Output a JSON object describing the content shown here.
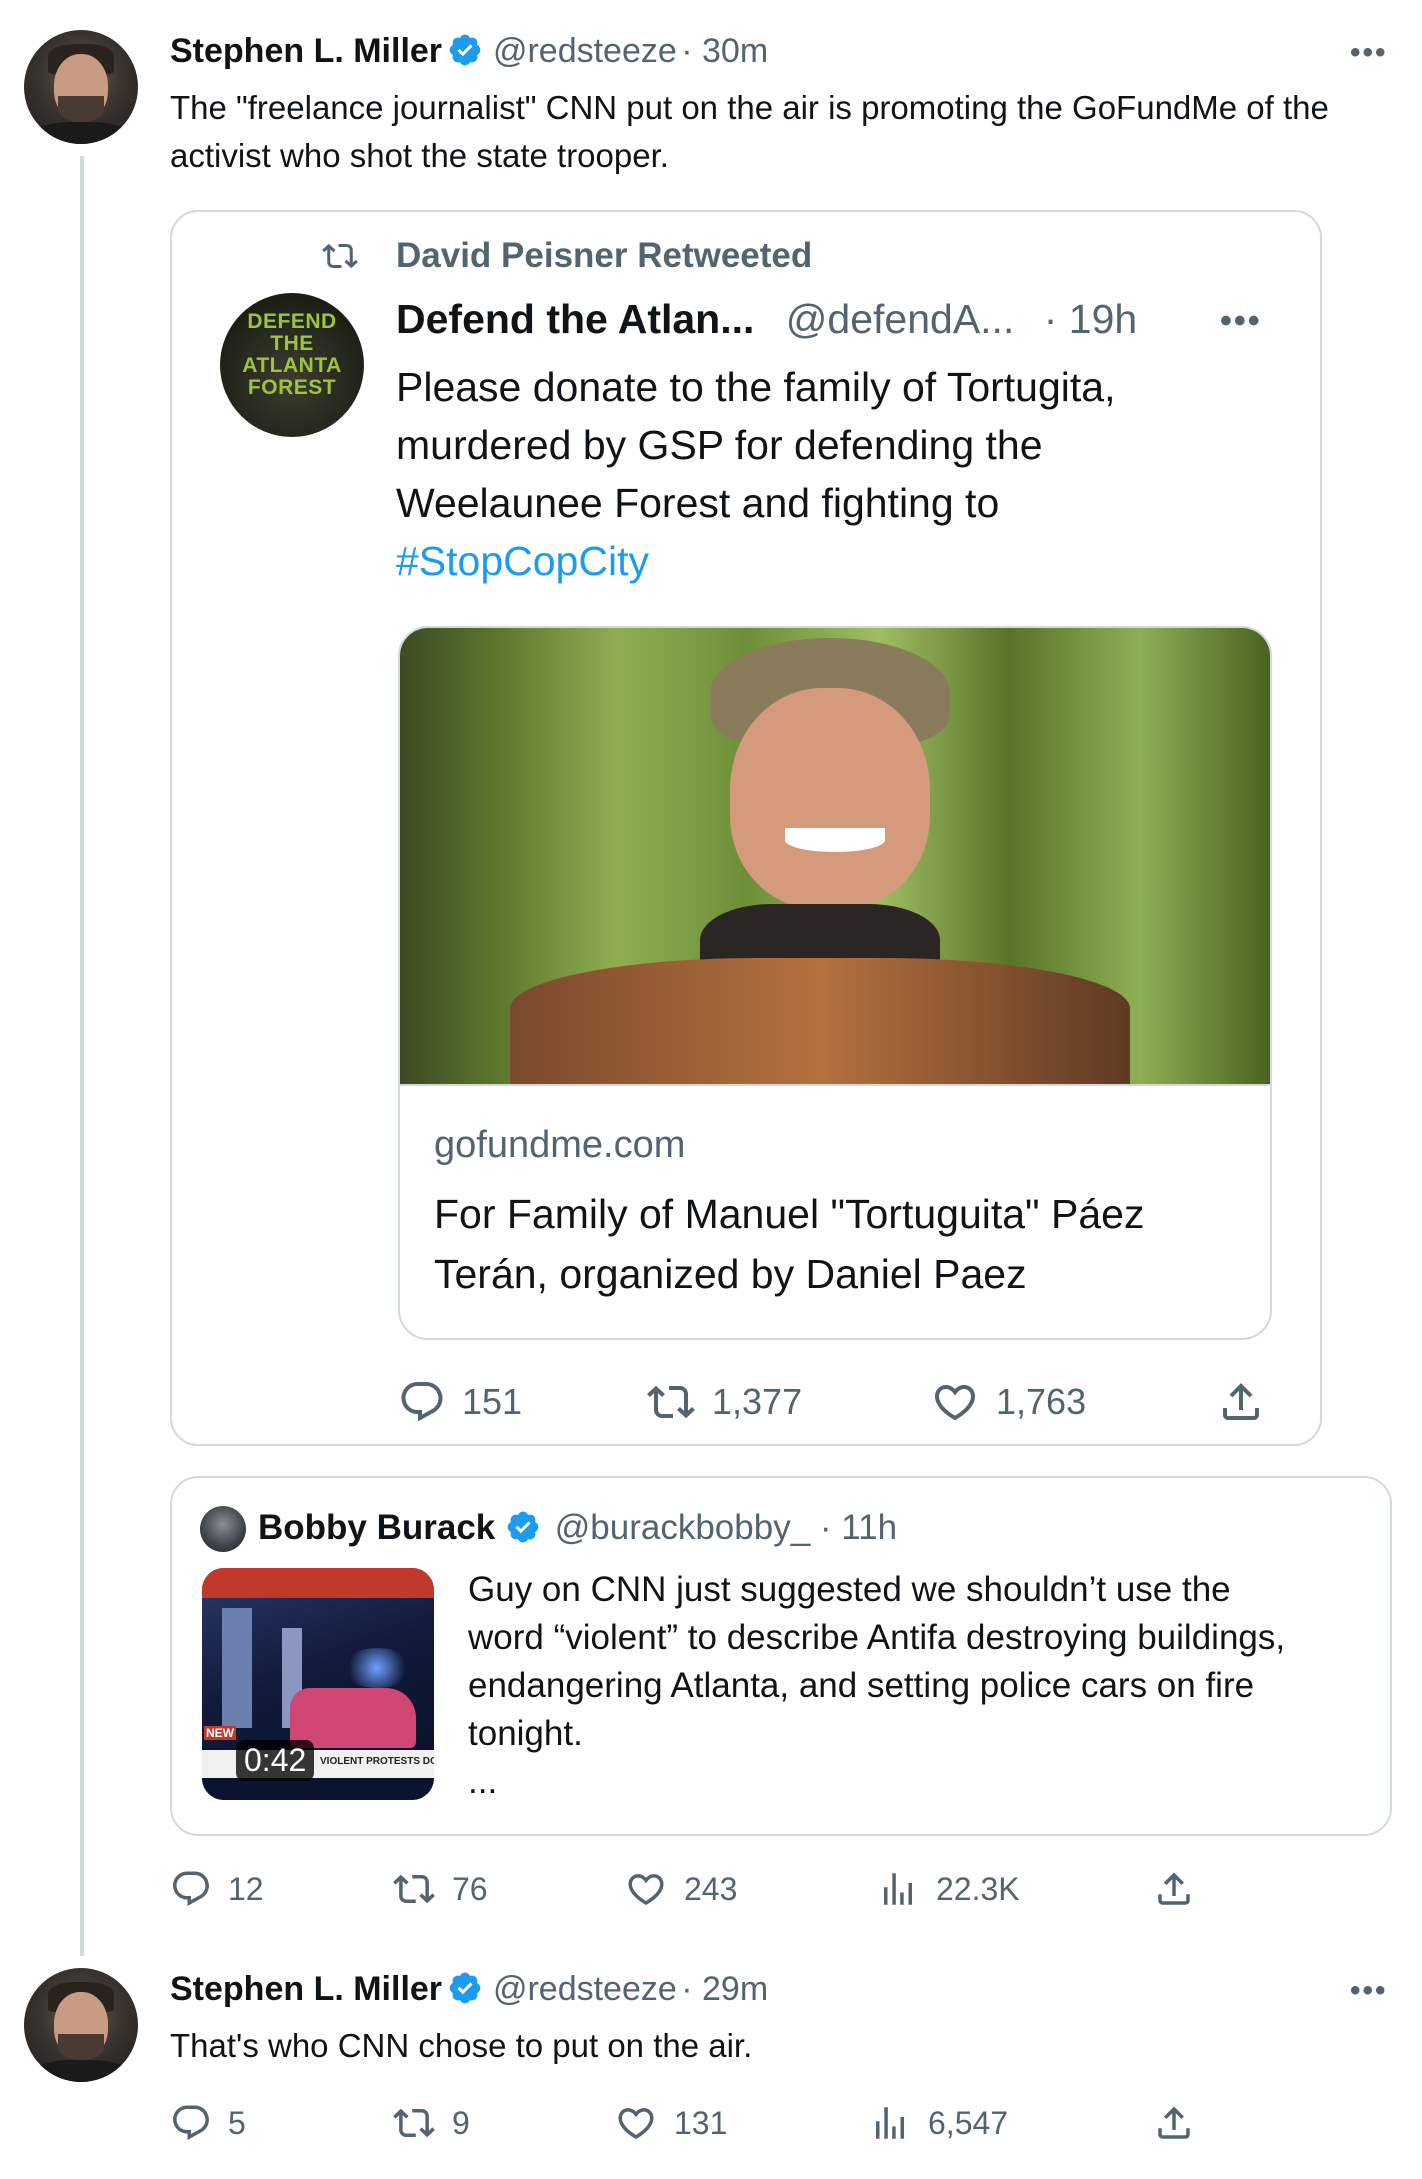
{
  "main_tweet": {
    "name": "Stephen L. Miller",
    "handle": "@redsteeze",
    "time": "· 30m",
    "text": "The \"freelance journalist\" CNN put on the air is promoting the GoFundMe of the activist who shot the state trooper.",
    "menu": "•••"
  },
  "quoted": {
    "retweeted_by": "David Peisner Retweeted",
    "name": "Defend the Atlan...",
    "handle": "@defendA...",
    "time": "· 19h",
    "avatar_text": [
      "DEFEND",
      "THE",
      "ATLANTA",
      "FOREST"
    ],
    "text_line1": "Please donate to the family of Tortugita,",
    "text_line2": "murdered by GSP for defending the",
    "text_line3": "Weelaunee Forest and fighting to",
    "hashtag": "#StopCopCity",
    "link_card": {
      "domain": "gofundme.com",
      "title_line1": "For Family of Manuel \"Tortuguita\" Páez",
      "title_line2": "Terán, organized by Daniel Paez"
    },
    "stats": {
      "replies": "151",
      "retweets": "1,377",
      "likes": "1,763"
    }
  },
  "quote_card": {
    "name": "Bobby Burack",
    "handle": "@burackbobby_",
    "time": "· 11h",
    "video_duration": "0:42",
    "video_chyron": "VIOLENT PROTESTS DOWNTOWN",
    "video_badge": "NEW",
    "text_line1": "Guy on CNN just suggested we shouldn’t use the",
    "text_line2": "word “violent” to describe Antifa destroying buildings,",
    "text_line3": "endangering Atlanta, and setting police cars on fire",
    "text_line4": "tonight.",
    "ellipsis": "..."
  },
  "main_stats": {
    "replies": "12",
    "retweets": "76",
    "likes": "243",
    "views": "22.3K"
  },
  "reply_tweet": {
    "name": "Stephen L. Miller",
    "handle": "@redsteeze",
    "time": "· 29m",
    "text": "That's who CNN chose to put on the air.",
    "menu": "•••"
  },
  "reply_stats": {
    "replies": "5",
    "retweets": "9",
    "likes": "131",
    "views": "6,547"
  },
  "colors": {
    "accent": "#1d9bf0",
    "muted": "#536471",
    "border": "#cfd9de"
  }
}
